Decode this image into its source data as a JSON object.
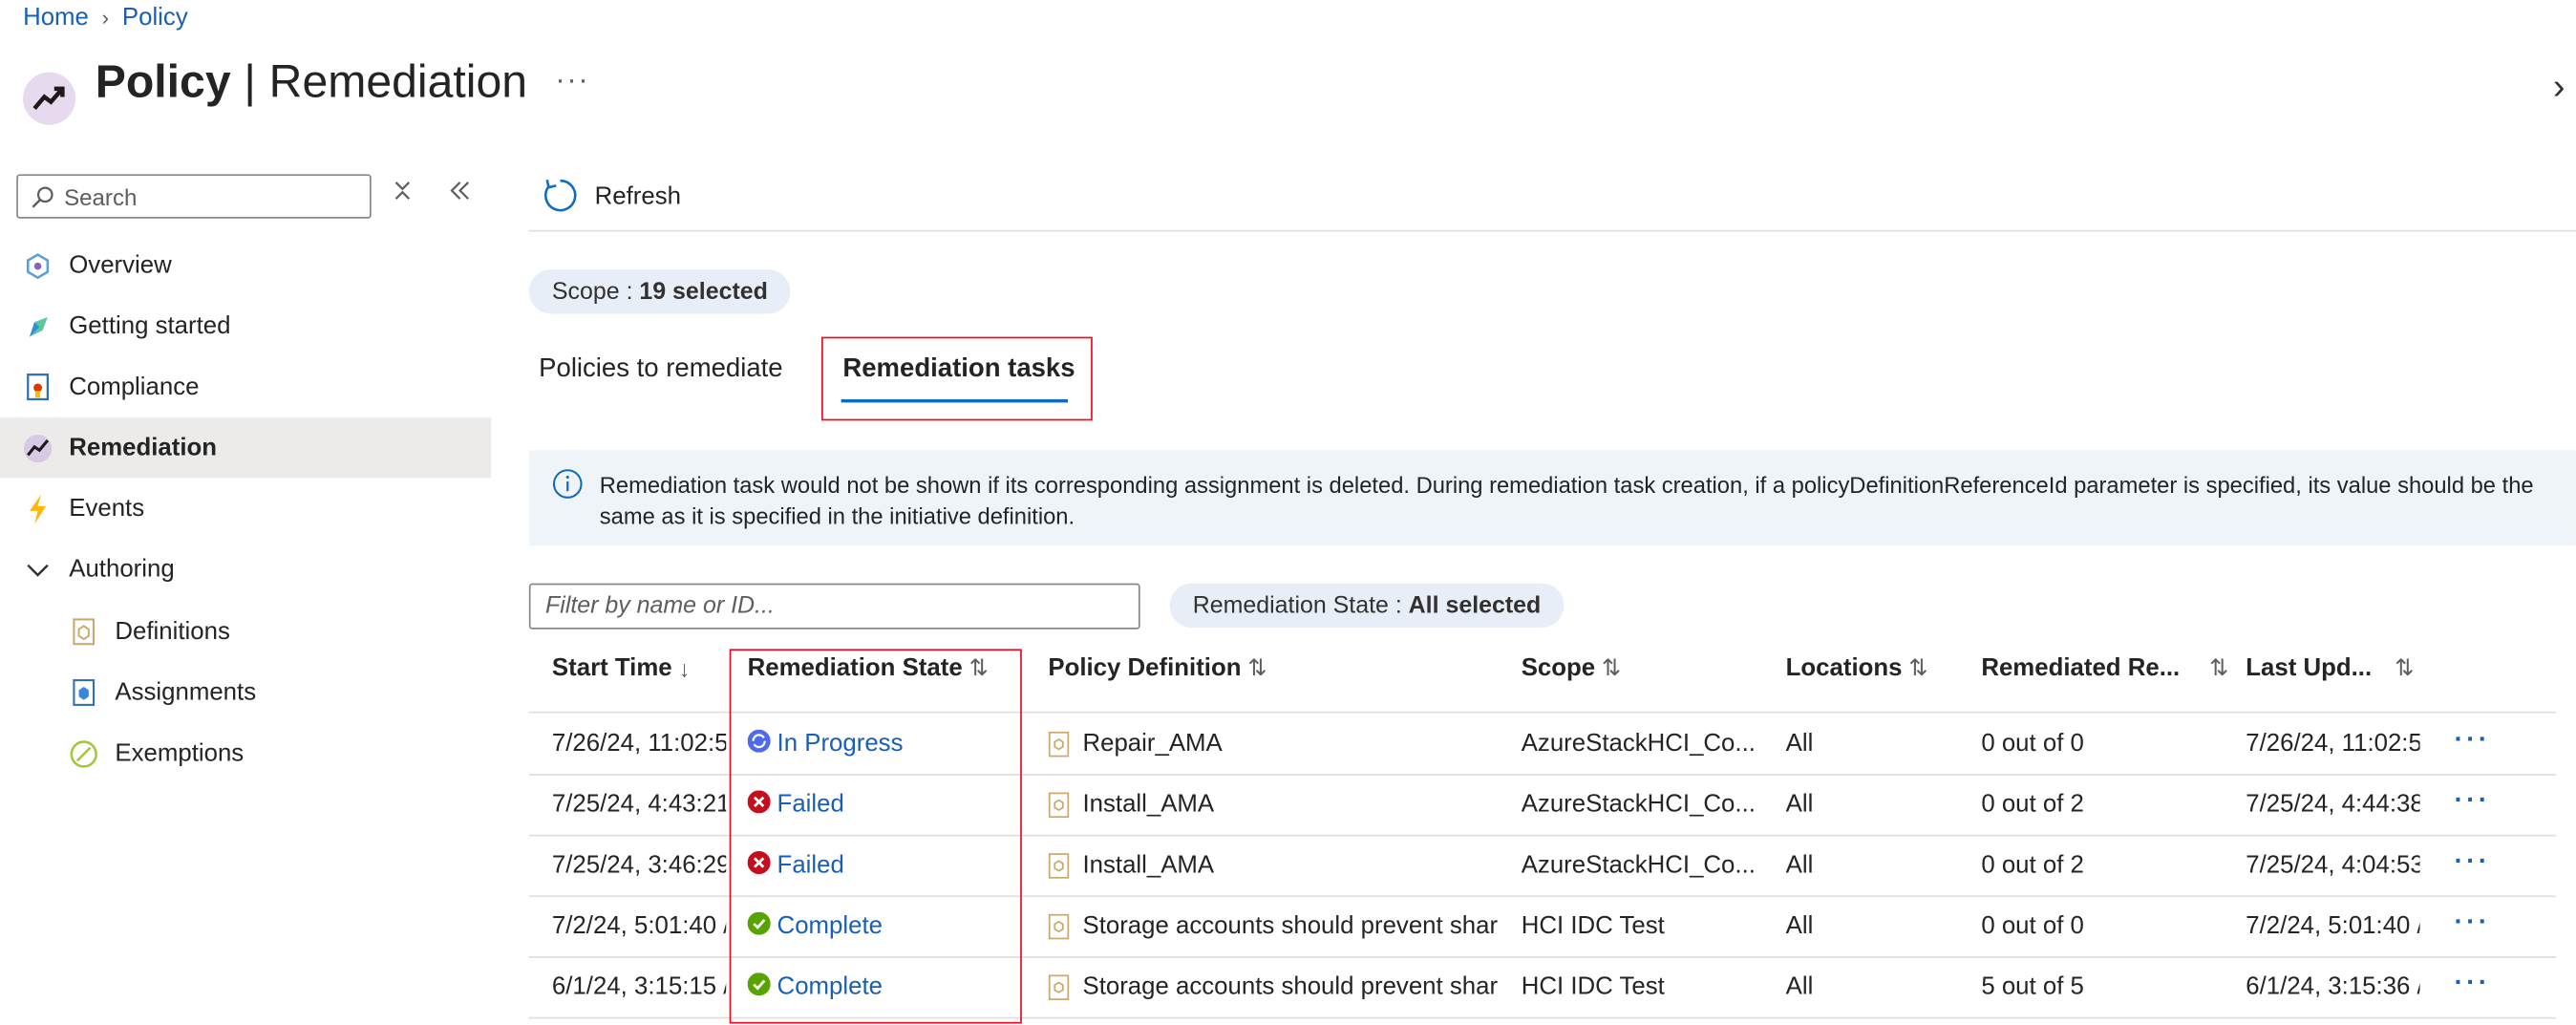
{
  "breadcrumb": {
    "home": "Home",
    "current": "Policy"
  },
  "title": {
    "main": "Policy",
    "sub": "Remediation",
    "more": "···"
  },
  "sidebar": {
    "search_placeholder": "Search",
    "items": [
      {
        "label": "Overview",
        "icon": "overview-icon"
      },
      {
        "label": "Getting started",
        "icon": "getting-started-icon"
      },
      {
        "label": "Compliance",
        "icon": "compliance-icon"
      },
      {
        "label": "Remediation",
        "icon": "remediation-icon",
        "active": true
      },
      {
        "label": "Events",
        "icon": "lightning-icon"
      },
      {
        "label": "Authoring",
        "icon": "chevron-down-icon"
      },
      {
        "label": "Definitions",
        "icon": "definitions-icon"
      },
      {
        "label": "Assignments",
        "icon": "assignments-icon"
      },
      {
        "label": "Exemptions",
        "icon": "exemptions-icon"
      }
    ]
  },
  "toolbar": {
    "refresh_label": "Refresh"
  },
  "scope_pill": {
    "label": "Scope :",
    "value": "19 selected"
  },
  "tabs": [
    {
      "label": "Policies to remediate"
    },
    {
      "label": "Remediation tasks",
      "active": true
    }
  ],
  "info": {
    "text": "Remediation task would not be shown if its corresponding assignment is deleted. During remediation task creation, if a policyDefinitionReferenceId parameter is specified, its value should be the same as it is specified in the initiative definition."
  },
  "filter": {
    "placeholder": "Filter by name or ID..."
  },
  "state_pill": {
    "label": "Remediation State :",
    "value": "All selected"
  },
  "table": {
    "headers": {
      "start_time": "Start Time",
      "start_time_sort": "↓",
      "state": "Remediation State",
      "definition": "Policy Definition",
      "scope": "Scope",
      "locations": "Locations",
      "remediated": "Remediated Re...",
      "last_updated": "Last Upd...",
      "sort": "⇅"
    },
    "rows": [
      {
        "start": "7/26/24, 11:02:5",
        "state": "In Progress",
        "status": "progress",
        "definition": "Repair_AMA",
        "scope": "AzureStackHCI_Co...",
        "locations": "All",
        "remediated": "0 out of 0",
        "updated": "7/26/24, 11:02:5"
      },
      {
        "start": "7/25/24, 4:43:21",
        "state": "Failed",
        "status": "failed",
        "definition": "Install_AMA",
        "scope": "AzureStackHCI_Co...",
        "locations": "All",
        "remediated": "0 out of 2",
        "updated": "7/25/24, 4:44:38"
      },
      {
        "start": "7/25/24, 3:46:29",
        "state": "Failed",
        "status": "failed",
        "definition": "Install_AMA",
        "scope": "AzureStackHCI_Co...",
        "locations": "All",
        "remediated": "0 out of 2",
        "updated": "7/25/24, 4:04:53"
      },
      {
        "start": "7/2/24, 5:01:40 /",
        "state": "Complete",
        "status": "complete",
        "definition": "Storage accounts should prevent shar",
        "scope": "HCI IDC Test",
        "locations": "All",
        "remediated": "0 out of 0",
        "updated": "7/2/24, 5:01:40 /"
      },
      {
        "start": "6/1/24, 3:15:15 /",
        "state": "Complete",
        "status": "complete",
        "definition": "Storage accounts should prevent shar",
        "scope": "HCI IDC Test",
        "locations": "All",
        "remediated": "5 out of 5",
        "updated": "6/1/24, 3:15:36 /"
      }
    ],
    "row_more": "···"
  },
  "colors": {
    "accent": "#0f6cbd",
    "highlight": "#e81123",
    "failed": "#c50f1f",
    "complete": "#57a300",
    "progress": "#4f6bed"
  }
}
